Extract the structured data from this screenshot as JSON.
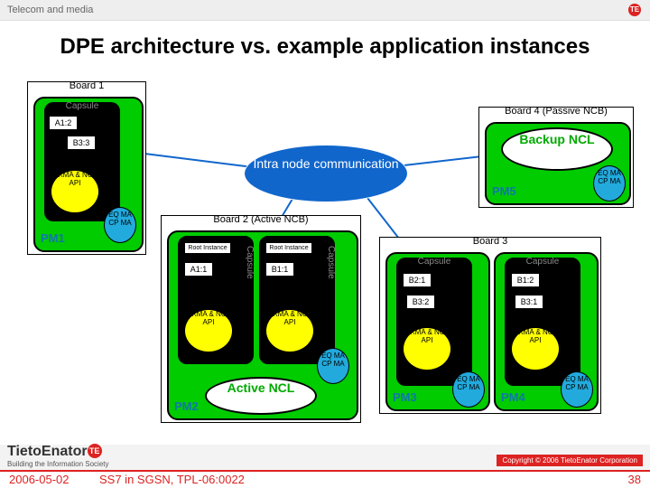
{
  "header": {
    "breadcrumb": "Telecom and media",
    "badge": "TE"
  },
  "title": "DPE architecture vs. example application instances",
  "hub": "Intra node communication",
  "boards": {
    "b1": {
      "label": "Board 1",
      "pm_label": "PM1",
      "capsule": "Capsule",
      "items": {
        "a12": "A1:2",
        "b33": "B3:3",
        "exm": "EXMA & NCL API",
        "eq": "EQ MA CP MA"
      }
    },
    "b2": {
      "label": "Board 2 (Active NCB)",
      "pm_label": "PM2",
      "cap1": {
        "title": "Capsule",
        "root": "Root Instance",
        "a11": "A1:1",
        "exm": "EXMA & NCL API"
      },
      "cap2": {
        "title": "Capsule",
        "root": "Root Instance",
        "b11": "B1:1",
        "exm": "EXMA & NCL API"
      },
      "eq": "EQ MA CP MA",
      "ncl": "Active NCL"
    },
    "b3": {
      "label": "Board 3",
      "pm3": {
        "label": "PM3",
        "capsule": "Capsule",
        "b21": "B2:1",
        "b32": "B3:2",
        "exm": "EXMA & NCL API",
        "eq": "EQ MA CP MA"
      },
      "pm4": {
        "label": "PM4",
        "capsule": "Capsule",
        "b12": "B1:2",
        "b31": "B3:1",
        "exm": "EXMA & NCL API",
        "eq": "EQ MA CP MA"
      }
    },
    "b4": {
      "label": "Board 4 (Passive NCB)",
      "pm_label": "PM5",
      "ncl": "Backup NCL",
      "eq": "EQ MA CP MA"
    }
  },
  "footer": {
    "logo": "TietoEnator",
    "logo_badge": "TE",
    "logo_sub": "Building the Information Society",
    "copyright": "Copyright © 2006 TietoEnator Corporation",
    "date": "2006-05-02",
    "docid": "SS7 in SGSN, TPL-06:0022",
    "page": "38"
  }
}
